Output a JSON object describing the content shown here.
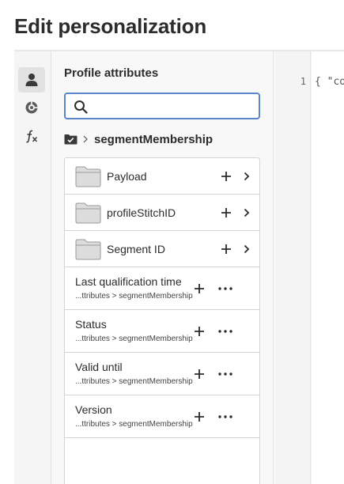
{
  "header": {
    "title": "Edit personalization"
  },
  "rail": {
    "items": [
      {
        "icon": "person-icon",
        "active": true
      },
      {
        "icon": "target-icon",
        "active": false
      },
      {
        "icon": "function-icon",
        "active": false
      }
    ]
  },
  "panel": {
    "title": "Profile attributes",
    "search": {
      "value": "",
      "placeholder": ""
    },
    "breadcrumb": {
      "label": "segmentMembership"
    },
    "items": [
      {
        "type": "folder",
        "label": "Payload"
      },
      {
        "type": "folder",
        "label": "profileStitchID"
      },
      {
        "type": "folder",
        "label": "Segment ID"
      },
      {
        "type": "leaf",
        "label": "Last qualification time",
        "path": "...ttributes > segmentMembership"
      },
      {
        "type": "leaf",
        "label": "Status",
        "path": "...ttributes > segmentMembership"
      },
      {
        "type": "leaf",
        "label": "Valid until",
        "path": "...ttributes > segmentMembership"
      },
      {
        "type": "leaf",
        "label": "Version",
        "path": "...ttributes > segmentMembership"
      }
    ]
  },
  "editor": {
    "line_number": "1",
    "code": "{ \"co"
  },
  "colors": {
    "search_border": "#5a86c9",
    "accent": "#5a86c9"
  }
}
